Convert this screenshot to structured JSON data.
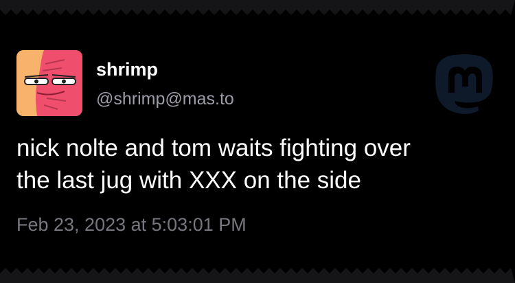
{
  "post": {
    "display_name": "shrimp",
    "handle": "@shrimp@mas.to",
    "text_lines": [
      "nick nolte and tom waits fighting over",
      "the last jug with XXX on the side"
    ],
    "timestamp": "Feb 23, 2023 at 5:03:01 PM"
  },
  "icons": {
    "avatar": "shrimp-avatar-icon",
    "logo": "mastodon-logo-icon"
  },
  "colors": {
    "background": "#000000",
    "name": "#ffffff",
    "handle": "#9c9ca8",
    "timestamp": "#77777f",
    "logo": "#0e1a2a",
    "avatar_orange": "#f7b36b",
    "avatar_pink": "#ef4f6c"
  }
}
